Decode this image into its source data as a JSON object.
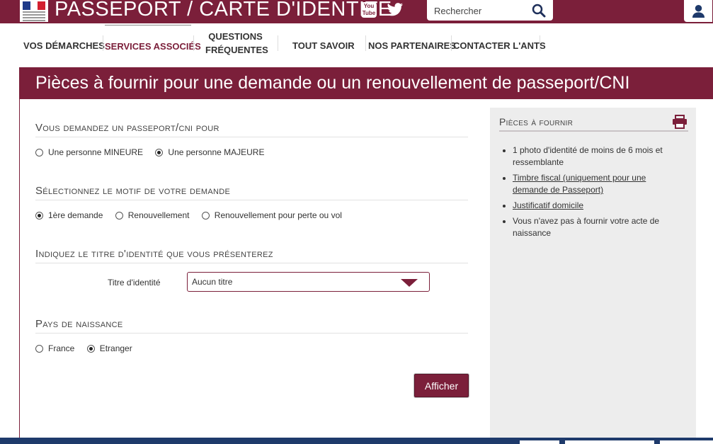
{
  "header": {
    "site_title": "PASSEPORT / CARTE D'IDENTITE",
    "youtube_label": "You Tube",
    "search_placeholder": "Rechercher"
  },
  "nav": {
    "items": [
      {
        "label": "VOS DÉMARCHES"
      },
      {
        "label": "SERVICES ASSOCIÉS"
      },
      {
        "label": "QUESTIONS FRÉQUENTES"
      },
      {
        "label": "TOUT SAVOIR"
      },
      {
        "label": "NOS PARTENAIRES"
      },
      {
        "label": "CONTACTER L'ANTS"
      }
    ],
    "questions_line1": "QUESTIONS",
    "questions_line2": "FRÉQUENTES"
  },
  "page_title": "Pièces à fournir pour une demande ou un renouvellement de passeport/CNI",
  "form": {
    "section1": {
      "title": "Vous demandez un passeport/cni pour",
      "options": [
        "Une personne MINEURE",
        "Une personne MAJEURE"
      ],
      "selected": 1
    },
    "section2": {
      "title": "Sélectionnez le motif de votre demande",
      "options": [
        "1ère demande",
        "Renouvellement",
        "Renouvellement pour perte ou vol"
      ],
      "selected": 0
    },
    "section3": {
      "title": "Indiquez le titre d'identité que vous présenterez",
      "field_label": "Titre d'identité",
      "select_value": "Aucun titre"
    },
    "section4": {
      "title": "Pays de naissance",
      "options": [
        "France",
        "Etranger"
      ],
      "selected": 1
    },
    "submit_label": "Afficher"
  },
  "sidebar": {
    "title": "Pièces à fournir",
    "items": [
      {
        "text": "1 photo d'identité de moins de 6 mois et ressemblante",
        "link": false
      },
      {
        "text": "Timbre fiscal (uniquement pour une demande de Passeport)",
        "link": true
      },
      {
        "text": "Justificatif domicile",
        "link": true
      },
      {
        "text": "Vous n'avez pas à fournir votre acte de naissance",
        "link": false
      }
    ]
  },
  "colors": {
    "brand": "#7b1f3a",
    "footer": "#1e3a6b",
    "sidebar_bg": "#ededed"
  }
}
